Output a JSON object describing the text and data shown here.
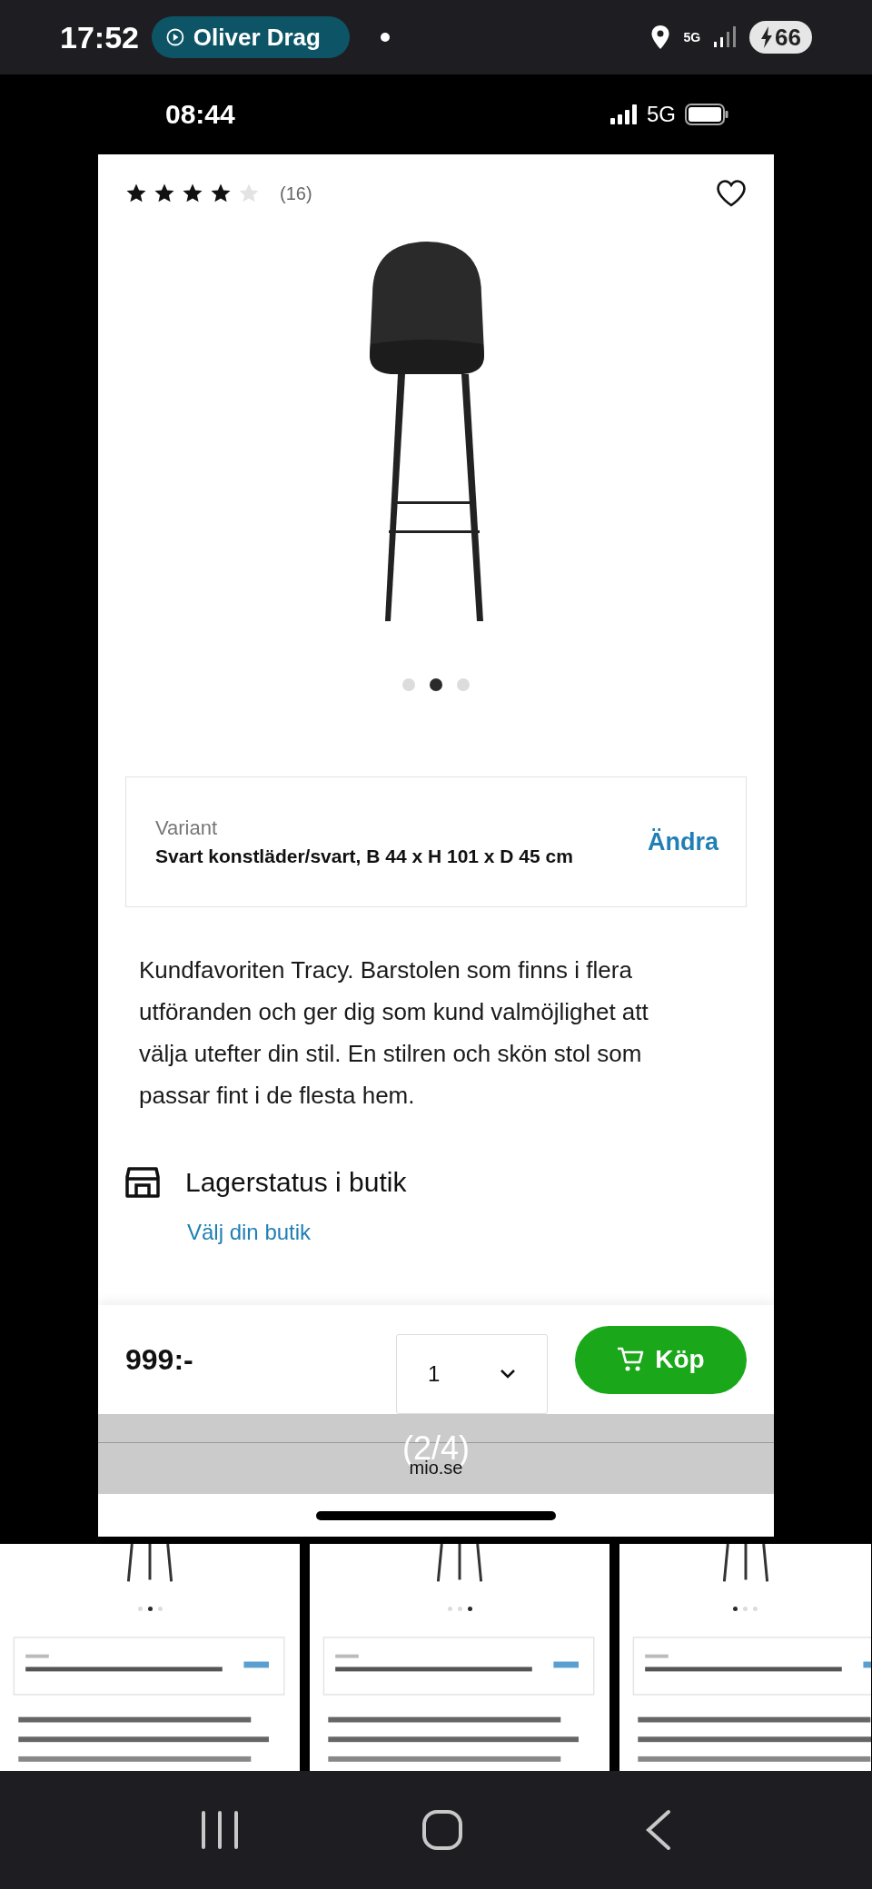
{
  "status_bar": {
    "time": "17:52",
    "media": "Oliver Drag",
    "battery": "66",
    "network": "5G"
  },
  "inner_status_bar": {
    "time": "08:44",
    "network": "5G"
  },
  "product": {
    "stars": 4,
    "review_count": "(16)",
    "carousel_dots": [
      {
        "selected": false
      },
      {
        "selected": true
      },
      {
        "selected": false
      }
    ],
    "variant": {
      "label": "Variant",
      "value": "Svart konstläder/svart, B 44 x H 101 x D 45 cm",
      "action": "Ändra"
    },
    "description": "Kundfavoriten Tracy. Barstolen som finns i flera utföranden och ger dig som kund valmöjlighet att välja utefter din stil. En stilren och skön stol som passar fint i de flesta hem.",
    "stock": {
      "title": "Lagerstatus i butik",
      "link": "Välj din butik"
    },
    "price": "999:-",
    "quantity": "1",
    "buy_button": "Köp"
  },
  "overlay": {
    "counter": "(2/4)",
    "site": "mio.se"
  },
  "thumbnails": [
    {
      "dots": [
        {
          "selected": false
        },
        {
          "selected": true
        },
        {
          "selected": false
        }
      ]
    },
    {
      "dots": [
        {
          "selected": false
        },
        {
          "selected": false
        },
        {
          "selected": true
        }
      ]
    },
    {
      "dots": [
        {
          "selected": true
        },
        {
          "selected": false
        },
        {
          "selected": false
        }
      ]
    }
  ]
}
